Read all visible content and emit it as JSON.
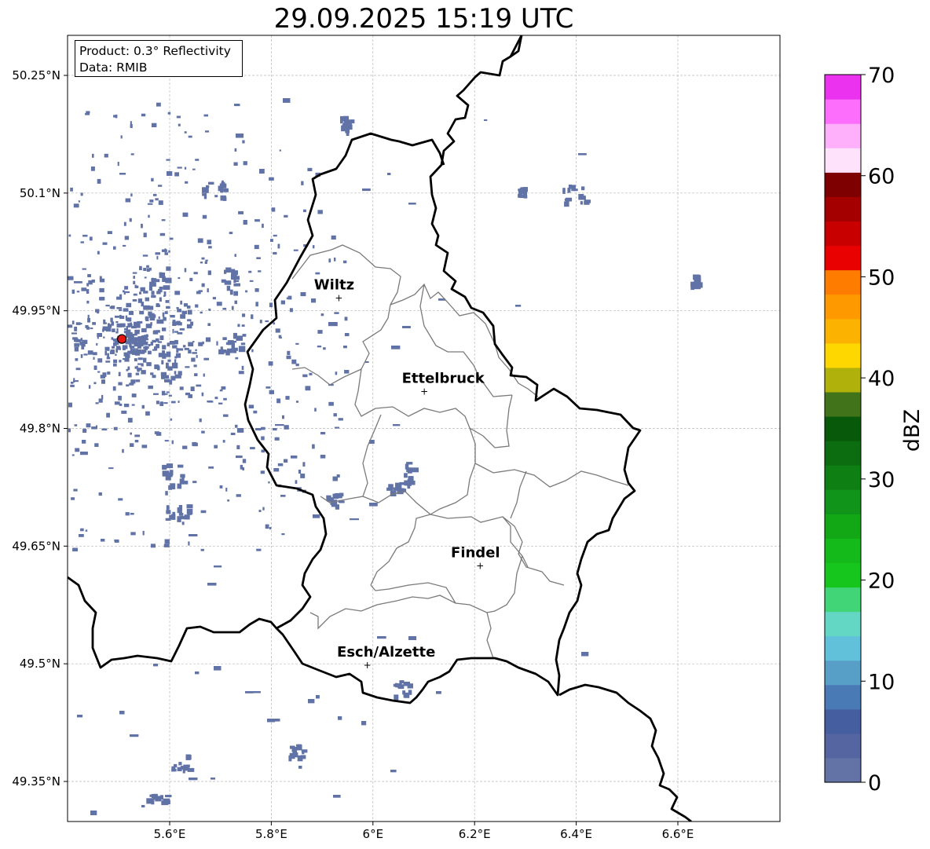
{
  "title": "29.09.2025 15:19 UTC",
  "info_box": {
    "product": "Product: 0.3° Reflectivity",
    "data_source": "Data: RMIB"
  },
  "map": {
    "lon_range": [
      5.4,
      6.8
    ],
    "lat_range": [
      49.3,
      50.3
    ],
    "lat_ticks": [
      {
        "value": 50.25,
        "label": "50.25°N"
      },
      {
        "value": 50.1,
        "label": "50.1°N"
      },
      {
        "value": 49.95,
        "label": "49.95°N"
      },
      {
        "value": 49.8,
        "label": "49.8°N"
      },
      {
        "value": 49.65,
        "label": "49.65°N"
      },
      {
        "value": 49.5,
        "label": "49.5°N"
      },
      {
        "value": 49.35,
        "label": "49.35°N"
      }
    ],
    "lon_ticks": [
      {
        "value": 5.6,
        "label": "5.6°E"
      },
      {
        "value": 5.8,
        "label": "5.8°E"
      },
      {
        "value": 6.0,
        "label": "6°E"
      },
      {
        "value": 6.2,
        "label": "6.2°E"
      },
      {
        "value": 6.4,
        "label": "6.4°E"
      },
      {
        "value": 6.6,
        "label": "6.6°E"
      }
    ],
    "grid": true,
    "radar_site": {
      "lon": 5.506,
      "lat": 49.914,
      "color": "#e8140f"
    },
    "cities": [
      {
        "name": "Wiltz",
        "lon": 5.933,
        "lat": 49.967
      },
      {
        "name": "Ettelbruck",
        "lon": 6.101,
        "lat": 49.848
      },
      {
        "name": "Findel",
        "lon": 6.211,
        "lat": 49.626
      },
      {
        "name": "Esch/Alzette",
        "lon": 5.989,
        "lat": 49.499
      }
    ],
    "echo_color": "#6173a6"
  },
  "colorbar": {
    "label": "dBZ",
    "min": 0,
    "max": 70,
    "ticks": [
      "0",
      "10",
      "20",
      "30",
      "40",
      "50",
      "60",
      "70"
    ],
    "colors": [
      "#6473a6",
      "#5465a1",
      "#455e9f",
      "#4a7ab6",
      "#589fc7",
      "#61c1da",
      "#63d7c4",
      "#41d577",
      "#16c61c",
      "#14b91a",
      "#12a715",
      "#10941a",
      "#0e7f13",
      "#0b6d0f",
      "#085a0a",
      "#41741a",
      "#b0b10a",
      "#fed600",
      "#fcb201",
      "#fe9a00",
      "#fe7d00",
      "#e90000",
      "#c90000",
      "#a50000",
      "#7e0000",
      "#fee1fb",
      "#feb1fa",
      "#fd6efc",
      "#ea32ef"
    ]
  }
}
